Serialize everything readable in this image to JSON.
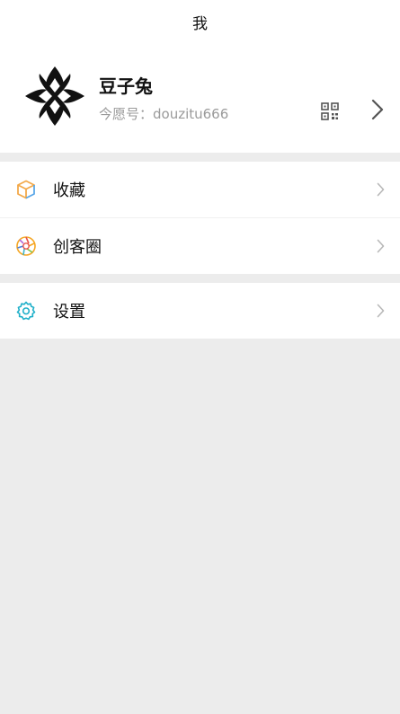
{
  "header": {
    "title": "我"
  },
  "profile": {
    "name": "豆子兔",
    "id_label": "今愿号：douzitu666",
    "qr_icon": "qr-code-icon",
    "chevron_icon": "chevron-right-icon"
  },
  "menu": {
    "group1": [
      {
        "label": "收藏",
        "icon": "cube-icon"
      },
      {
        "label": "创客圈",
        "icon": "aperture-icon"
      }
    ],
    "group2": [
      {
        "label": "设置",
        "icon": "gear-icon"
      }
    ]
  },
  "colors": {
    "background": "#ececec",
    "surface": "#ffffff",
    "accent": "#1fb0c9",
    "muted_text": "#9a9a9a"
  }
}
